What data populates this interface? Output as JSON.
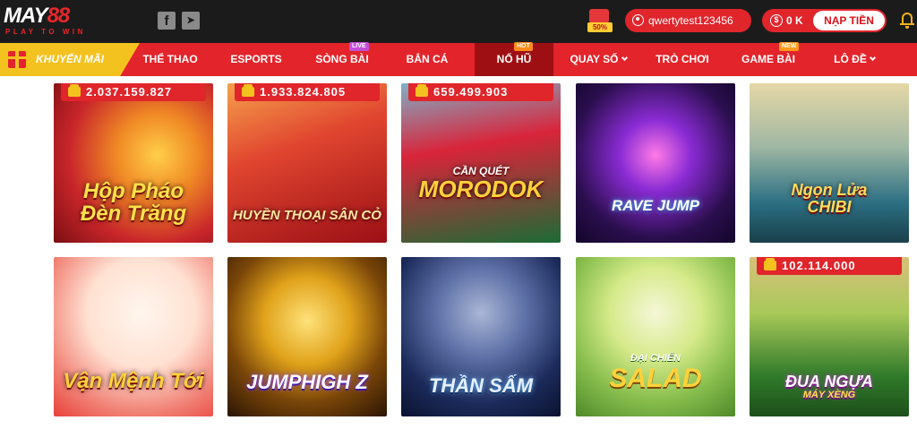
{
  "header": {
    "logo_text_a": "MAY",
    "logo_text_b": "88",
    "logo_tagline": "PLAY TO WIN",
    "social": [
      {
        "name": "facebook-icon",
        "glyph": "f"
      },
      {
        "name": "telegram-icon",
        "glyph": "➤"
      }
    ],
    "promo_badge": "50%",
    "username": "qwertytest123456",
    "balance": "0 K",
    "balance_symbol": "$",
    "deposit_label": "NẠP TIỀN"
  },
  "nav": {
    "promo_label": "KHUYẾN MÃI",
    "items": [
      {
        "label": "THỂ THAO",
        "tag": "",
        "dropdown": false,
        "active": false
      },
      {
        "label": "ESPORTS",
        "tag": "",
        "dropdown": false,
        "active": false
      },
      {
        "label": "SÒNG BÀI",
        "tag": "LIVE",
        "dropdown": false,
        "active": false
      },
      {
        "label": "BẮN CÁ",
        "tag": "",
        "dropdown": false,
        "active": false
      },
      {
        "label": "NỔ HŨ",
        "tag": "HOT",
        "dropdown": false,
        "active": true
      },
      {
        "label": "QUAY SỐ",
        "tag": "",
        "dropdown": true,
        "active": false
      },
      {
        "label": "TRÒ CHƠI",
        "tag": "",
        "dropdown": false,
        "active": false
      },
      {
        "label": "GAME BÀI",
        "tag": "NEW",
        "dropdown": false,
        "active": false
      },
      {
        "label": "LÔ ĐỀ",
        "tag": "",
        "dropdown": true,
        "active": false
      }
    ]
  },
  "games": [
    {
      "title_line1": "Hộp Pháo",
      "title_line2": "Đèn Trăng",
      "jackpot": "2.037.159.827",
      "colors": [
        "#c9262a",
        "#f3a232"
      ]
    },
    {
      "title_line1": "",
      "title_line2": "HUYỀN THOẠI SÂN CỎ",
      "jackpot": "1.933.824.805",
      "colors": [
        "#b11218",
        "#f07a3a"
      ]
    },
    {
      "title_line1": "CẦN QUÉT",
      "title_line2": "MORODOK",
      "jackpot": "659.499.903",
      "colors": [
        "#1c6b35",
        "#d9243a"
      ]
    },
    {
      "title_line1": "",
      "title_line2": "RAVE JUMP",
      "jackpot": "",
      "colors": [
        "#2a0e4d",
        "#b43ad4"
      ]
    },
    {
      "title_line1": "Ngọn Lửa",
      "title_line2": "CHIBI",
      "jackpot": "",
      "colors": [
        "#2c6f83",
        "#c7b27a"
      ]
    },
    {
      "title_line1": "",
      "title_line2": "Vận Mệnh Tới",
      "jackpot": "",
      "colors": [
        "#fff0e6",
        "#e9403a"
      ]
    },
    {
      "title_line1": "",
      "title_line2": "JUMPHIGH Z",
      "jackpot": "",
      "colors": [
        "#3b1c05",
        "#e0a21a"
      ]
    },
    {
      "title_line1": "",
      "title_line2": "THẦN SẤM",
      "jackpot": "",
      "colors": [
        "#0f1a3b",
        "#5c6fa6"
      ]
    },
    {
      "title_line1": "ĐẠI CHIẾN",
      "title_line2": "SALAD",
      "jackpot": "",
      "colors": [
        "#6aa23c",
        "#d6ea8a"
      ]
    },
    {
      "title_line1": "ĐUA NGỰA",
      "title_line2": "MÁY XÈNG",
      "jackpot": "102.114.000",
      "colors": [
        "#2f7a2a",
        "#a9c95a"
      ]
    }
  ]
}
